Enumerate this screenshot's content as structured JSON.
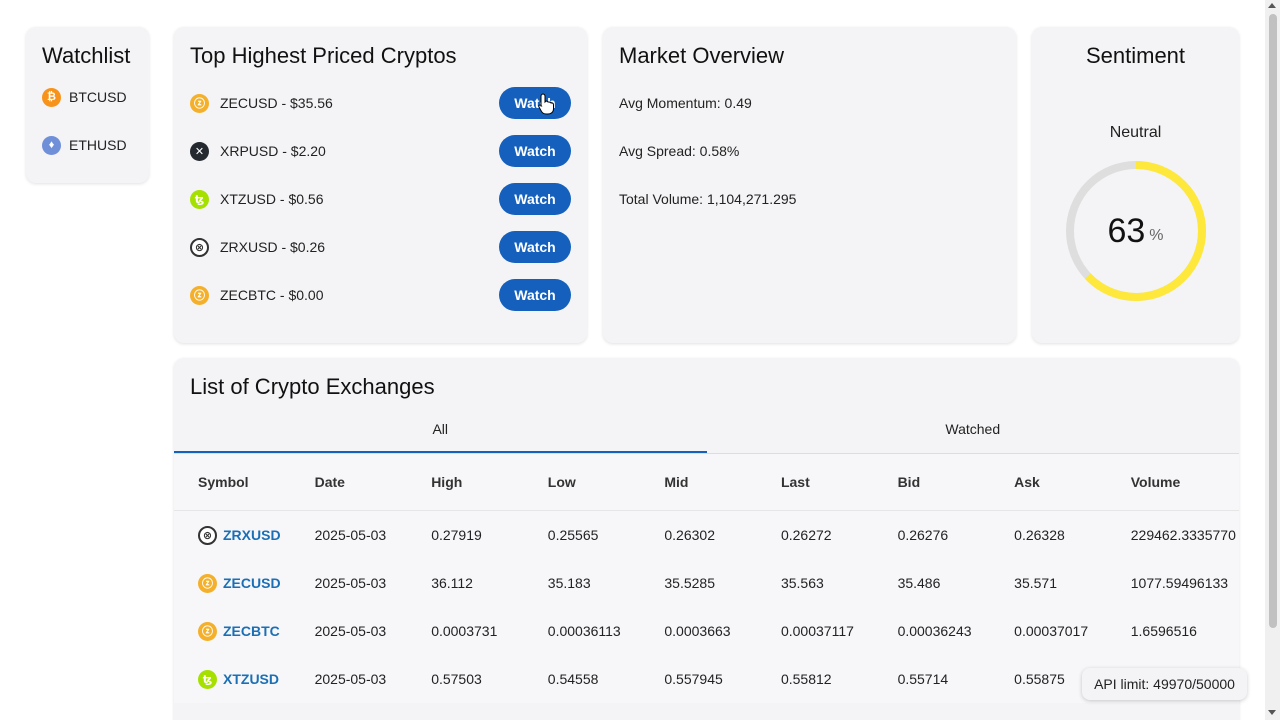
{
  "watchlist": {
    "title": "Watchlist",
    "items": [
      {
        "symbol": "BTCUSD",
        "icon": "bitcoin-icon",
        "glyph": "₿"
      },
      {
        "symbol": "ETHUSD",
        "icon": "ethereum-icon",
        "glyph": "♦"
      }
    ]
  },
  "top_cryptos": {
    "title": "Top Highest Priced Cryptos",
    "button_label": "Watch",
    "items": [
      {
        "label": "ZECUSD - $35.56",
        "icon": "zcash-icon"
      },
      {
        "label": "XRPUSD - $2.20",
        "icon": "xrp-icon"
      },
      {
        "label": "XTZUSD - $0.56",
        "icon": "tezos-icon"
      },
      {
        "label": "ZRXUSD - $0.26",
        "icon": "0x-icon"
      },
      {
        "label": "ZECBTC - $0.00",
        "icon": "zcash-icon"
      }
    ]
  },
  "market_overview": {
    "title": "Market Overview",
    "items": [
      "Avg Momentum: 0.49",
      "Avg Spread: 0.58%",
      "Total Volume: 1,104,271.295"
    ]
  },
  "sentiment": {
    "title": "Sentiment",
    "label": "Neutral",
    "value": "63",
    "unit": "%",
    "fraction": 0.63,
    "gauge_color": "#ffe83c",
    "track_color": "#dedede"
  },
  "exchanges": {
    "title": "List of Crypto Exchanges",
    "tabs": [
      "All",
      "Watched"
    ],
    "active_tab": "All",
    "columns": [
      "Symbol",
      "Date",
      "High",
      "Low",
      "Mid",
      "Last",
      "Bid",
      "Ask",
      "Volume"
    ],
    "rows": [
      {
        "symbol": "ZRXUSD",
        "icon": "0x-icon",
        "date": "2025-05-03",
        "high": "0.27919",
        "low": "0.25565",
        "mid": "0.26302",
        "last": "0.26272",
        "bid": "0.26276",
        "ask": "0.26328",
        "volume": "229462.3335770"
      },
      {
        "symbol": "ZECUSD",
        "icon": "zcash-icon",
        "date": "2025-05-03",
        "high": "36.112",
        "low": "35.183",
        "mid": "35.5285",
        "last": "35.563",
        "bid": "35.486",
        "ask": "35.571",
        "volume": "1077.59496133"
      },
      {
        "symbol": "ZECBTC",
        "icon": "zcash-icon",
        "date": "2025-05-03",
        "high": "0.0003731",
        "low": "0.00036113",
        "mid": "0.0003663",
        "last": "0.00037117",
        "bid": "0.00036243",
        "ask": "0.00037017",
        "volume": "1.6596516"
      },
      {
        "symbol": "XTZUSD",
        "icon": "tezos-icon",
        "date": "2025-05-03",
        "high": "0.57503",
        "low": "0.54558",
        "mid": "0.557945",
        "last": "0.55812",
        "bid": "0.55714",
        "ask": "0.55875",
        "volume": ""
      }
    ]
  },
  "api_limit": "API limit: 49970/50000",
  "colors": {
    "accent": "#1560bd",
    "link": "#1a6fb5",
    "card_bg": "#f4f4f6"
  }
}
